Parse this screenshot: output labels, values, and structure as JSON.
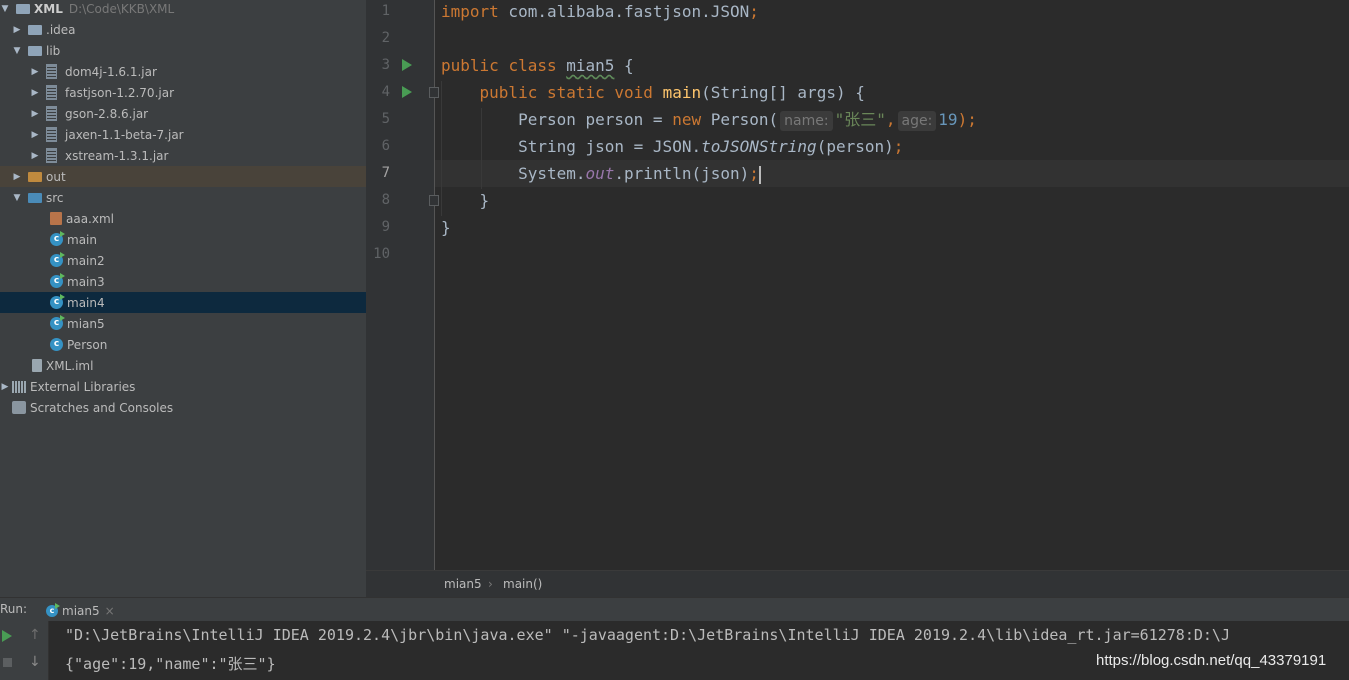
{
  "project": {
    "root": {
      "label": "XML",
      "path": "D:\\Code\\KKB\\XML"
    },
    "items": [
      {
        "label": ".idea"
      },
      {
        "label": "lib"
      },
      {
        "label": "dom4j-1.6.1.jar"
      },
      {
        "label": "fastjson-1.2.70.jar"
      },
      {
        "label": "gson-2.8.6.jar"
      },
      {
        "label": "jaxen-1.1-beta-7.jar"
      },
      {
        "label": "xstream-1.3.1.jar"
      },
      {
        "label": "out"
      },
      {
        "label": "src"
      },
      {
        "label": "aaa.xml"
      },
      {
        "label": "main"
      },
      {
        "label": "main2"
      },
      {
        "label": "main3"
      },
      {
        "label": "main4"
      },
      {
        "label": "mian5"
      },
      {
        "label": "Person"
      },
      {
        "label": "XML.iml"
      },
      {
        "label": "External Libraries"
      },
      {
        "label": "Scratches and Consoles"
      }
    ]
  },
  "editor": {
    "line_numbers": [
      "1",
      "2",
      "3",
      "4",
      "5",
      "6",
      "7",
      "8",
      "9",
      "10"
    ],
    "current_line": 7,
    "code": {
      "l1_kw": "import",
      "l1_rest": " com.alibaba.fastjson.JSON",
      "l1_semi": ";",
      "l3_public": "public",
      "l3_class": "class",
      "l3_name": "mian5",
      "l3_brace": " {",
      "l4_mods": "public static void",
      "l4_main": "main",
      "l4_params": "(String[] args) {",
      "l5_a": "Person person = ",
      "l5_new": "new",
      "l5_b": " Person(",
      "l5_hint_name": "name:",
      "l5_str": "\"张三\"",
      "l5_comma": ",",
      "l5_hint_age": "age:",
      "l5_num": "19",
      "l5_end": ");",
      "l6_a": "String json = JSON.",
      "l6_method": "toJSONString",
      "l6_b": "(person)",
      "l6_semi": ";",
      "l7_a": "System.",
      "l7_out": "out",
      "l7_b": ".println(json)",
      "l7_semi": ";",
      "l8": "}",
      "l9": "}"
    }
  },
  "breadcrumb": {
    "class": "mian5",
    "separator": "›",
    "method": "main()"
  },
  "run": {
    "label": "Run:",
    "tab": "mian5",
    "close": "×",
    "output": [
      "\"D:\\JetBrains\\IntelliJ IDEA 2019.2.4\\jbr\\bin\\java.exe\" \"-javaagent:D:\\JetBrains\\IntelliJ IDEA 2019.2.4\\lib\\idea_rt.jar=61278:D:\\J",
      "{\"age\":19,\"name\":\"张三\"}"
    ]
  },
  "watermark": "https://blog.csdn.net/qq_43379191",
  "colors": {
    "keyword": "#cc7832",
    "string": "#6a8759",
    "number": "#6897bb",
    "method_decl": "#ffc66d",
    "static_field": "#9876aa",
    "selection": "#0d293e"
  }
}
